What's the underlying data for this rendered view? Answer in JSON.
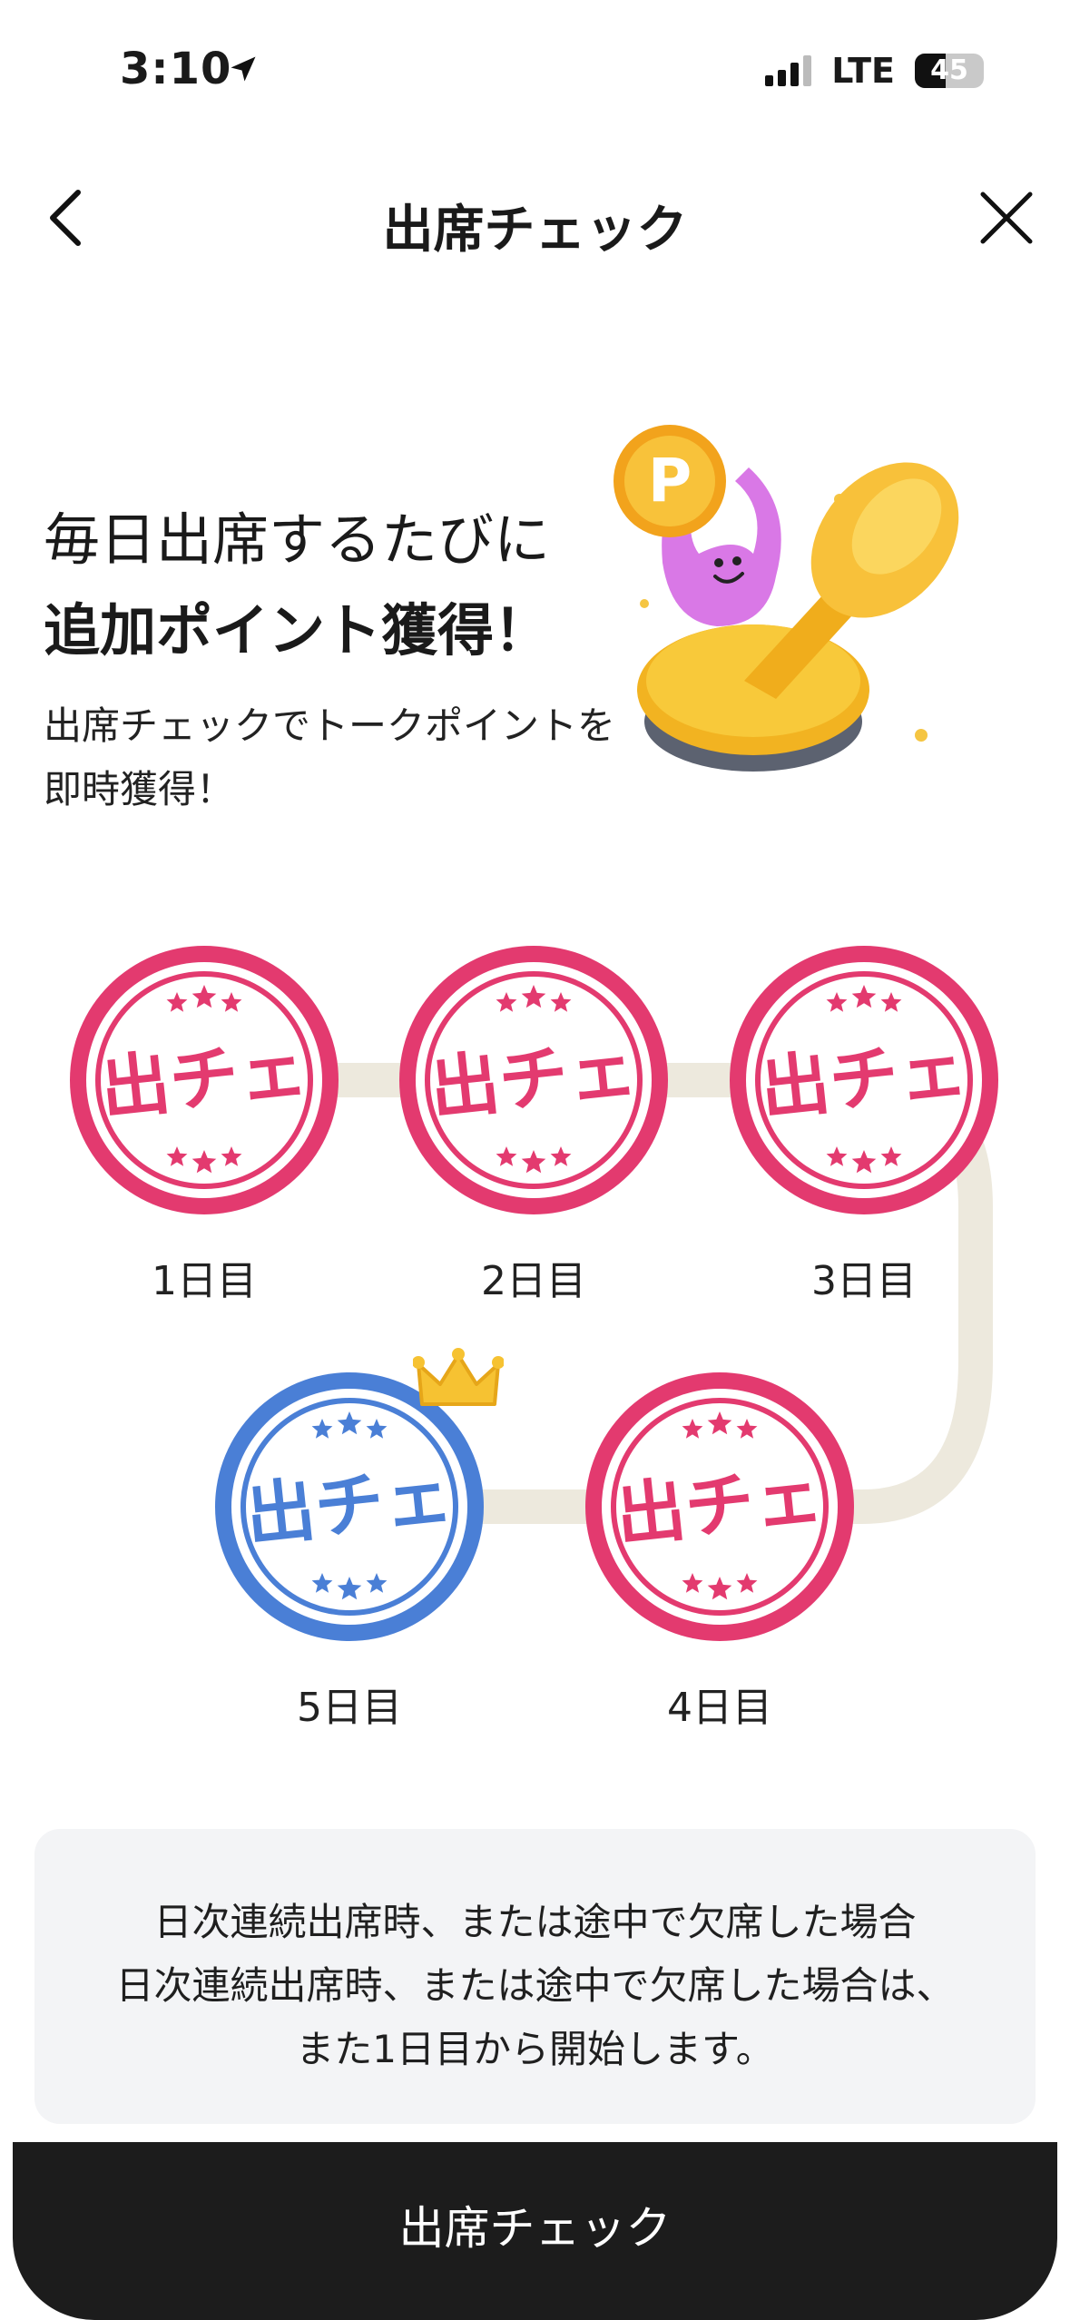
{
  "status_bar": {
    "time": "3:10",
    "network": "LTE",
    "battery": "45",
    "battery_level": 0.45
  },
  "header": {
    "title": "出席チェック",
    "back_icon": "chevron-left-icon",
    "close_icon": "close-icon"
  },
  "hero": {
    "title_line1": "毎日出席するたびに",
    "title_line2": "追加ポイント獲得！",
    "subtitle_line1": "出席チェックでトークポイントを",
    "subtitle_line2": "即時獲得！",
    "illustration_coin_letter": "P"
  },
  "stamps": [
    {
      "label": "1日目",
      "stamp_text": "出チェ",
      "color": "#e33a6f",
      "crown": false
    },
    {
      "label": "2日目",
      "stamp_text": "出チェ",
      "color": "#e33a6f",
      "crown": false
    },
    {
      "label": "3日目",
      "stamp_text": "出チェ",
      "color": "#e33a6f",
      "crown": false
    },
    {
      "label": "4日目",
      "stamp_text": "出チェ",
      "color": "#e33a6f",
      "crown": false
    },
    {
      "label": "5日目",
      "stamp_text": "出チェ",
      "color": "#4a7fd6",
      "crown": true
    }
  ],
  "notice": {
    "line1": "日次連続出席時、または途中で欠席した場合",
    "line2": "日次連続出席時、または途中で欠席した場合は、",
    "line3": "また1日目から開始します。"
  },
  "cta": {
    "label": "出席チェック"
  },
  "colors": {
    "stamp_pink": "#e33a6f",
    "stamp_blue": "#4a7fd6",
    "highlight": "#fdf0b8",
    "track": "#ede9dd",
    "cta_bg": "#1c1c1c"
  }
}
